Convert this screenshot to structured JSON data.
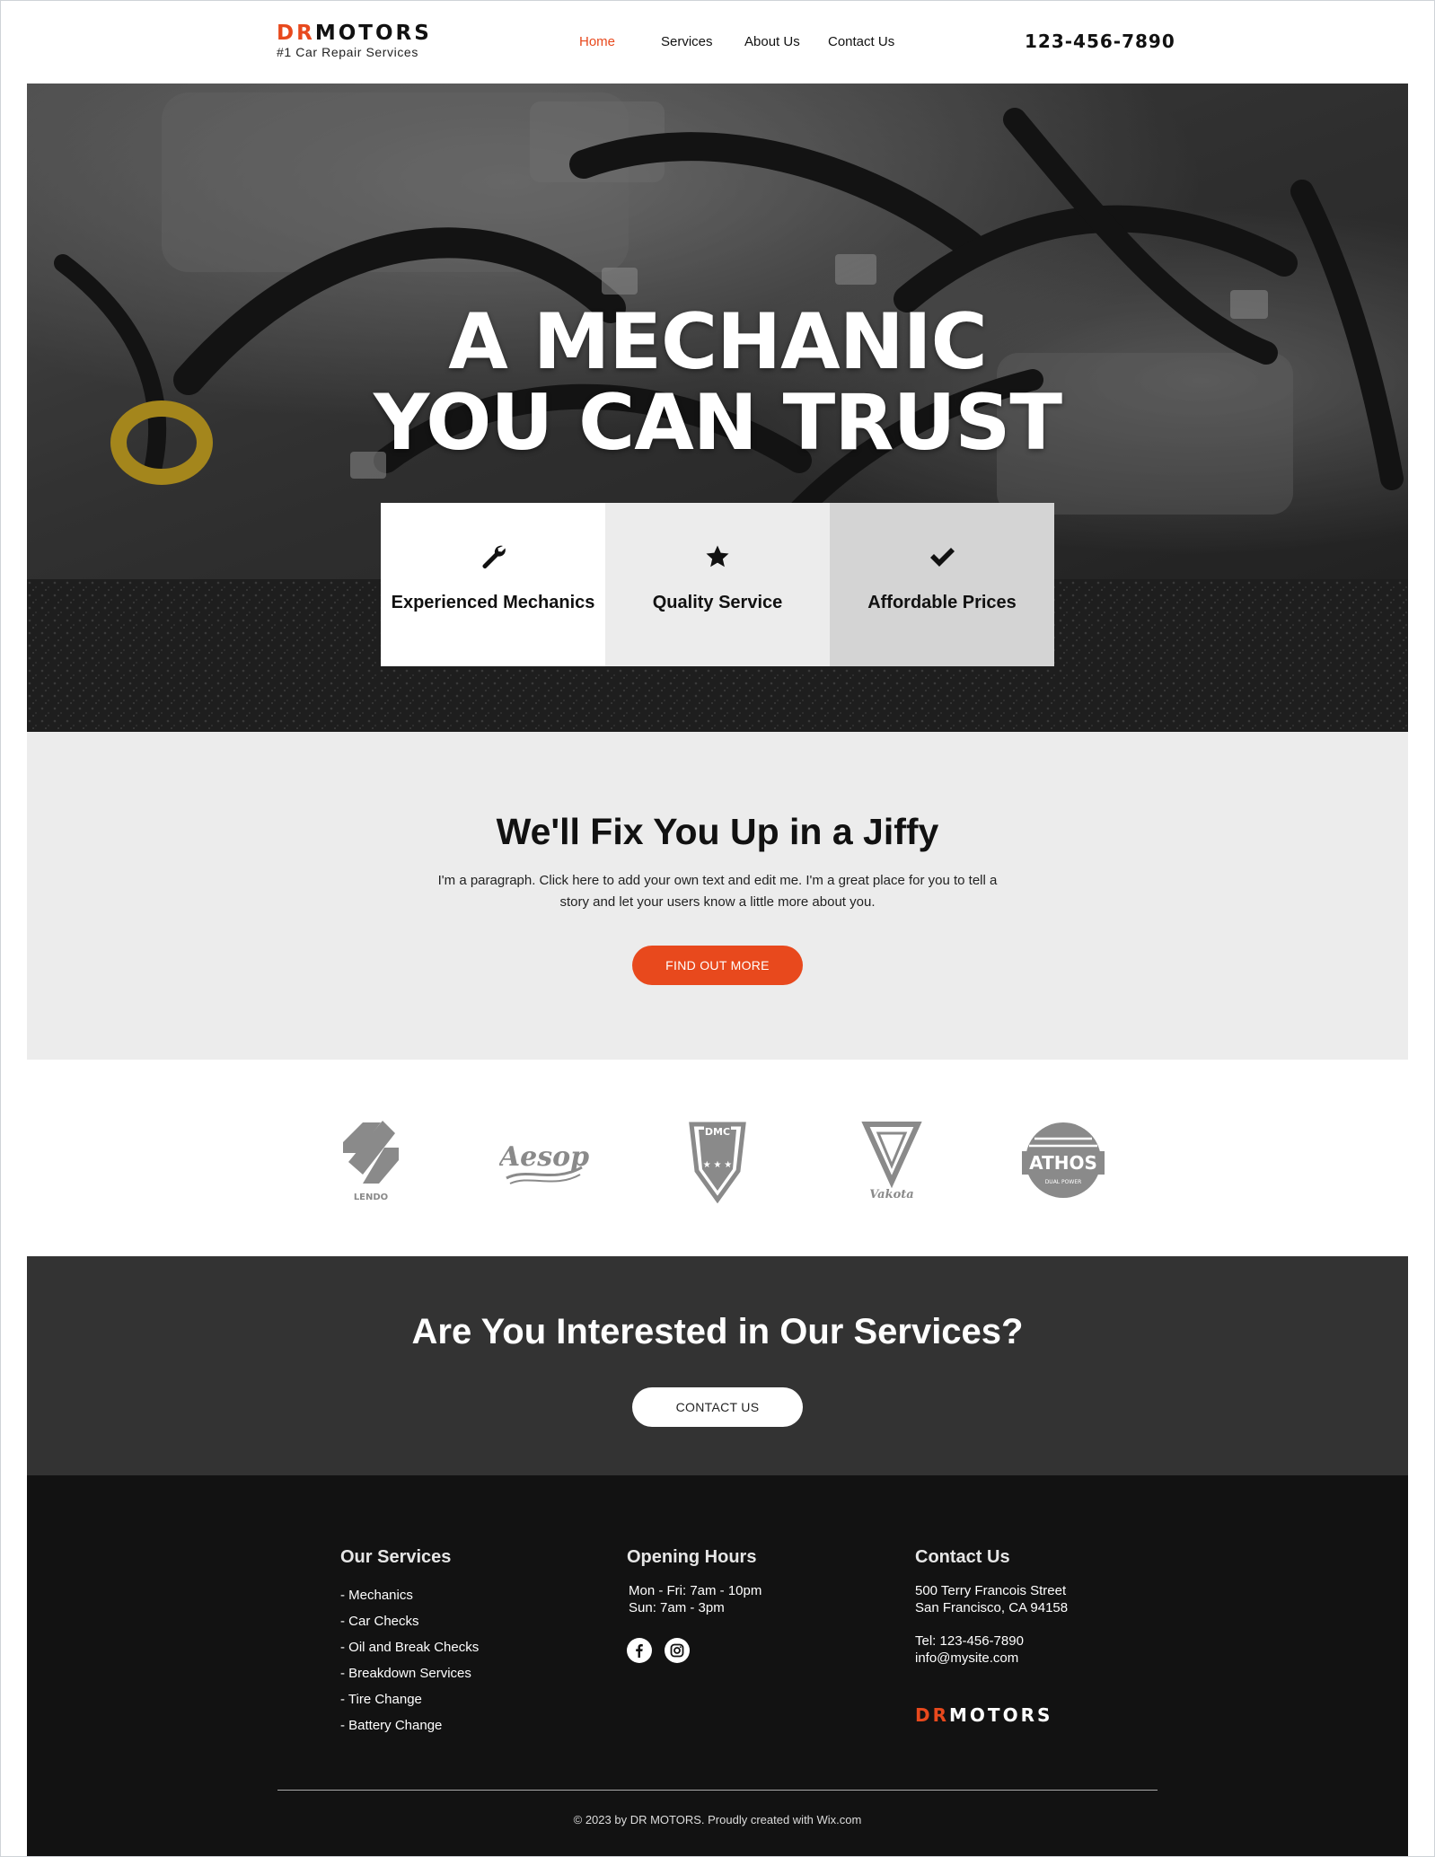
{
  "header": {
    "logo_dr": "DR",
    "logo_motors": "MOTORS",
    "tagline": "#1 Car Repair Services",
    "nav": [
      {
        "label": "Home",
        "active": true
      },
      {
        "label": "Services",
        "active": false
      },
      {
        "label": "About Us",
        "active": false
      },
      {
        "label": "Contact Us",
        "active": false
      }
    ],
    "phone": "123-456-7890"
  },
  "hero": {
    "title_line1": "A MECHANIC",
    "title_line2": "YOU CAN TRUST",
    "features": [
      {
        "label": "Experienced Mechanics",
        "icon": "wrench-icon"
      },
      {
        "label": "Quality Service",
        "icon": "star-icon"
      },
      {
        "label": "Affordable Prices",
        "icon": "checkmark-icon"
      }
    ]
  },
  "intro": {
    "heading": "We'll Fix You Up in a Jiffy",
    "paragraph": "I'm a paragraph. Click here to add your own text and edit me. I'm a great place for you to tell a story and let your users know a little more about you.",
    "button": "FIND OUT MORE"
  },
  "brands": [
    {
      "name": "LENDO"
    },
    {
      "name": "Aesop"
    },
    {
      "name": "DMC"
    },
    {
      "name": "Vakota"
    },
    {
      "name": "ATHOS",
      "sub": "DUAL POWER"
    }
  ],
  "cta": {
    "heading": "Are You Interested in Our Services?",
    "button": "CONTACT US"
  },
  "footer": {
    "services_title": "Our Services",
    "services": [
      "- Mechanics",
      "- Car Checks",
      "- Oil and Break Checks",
      "- Breakdown Services",
      "- Tire Change",
      "- Battery Change"
    ],
    "hours_title": "Opening Hours",
    "hours": [
      "Mon - Fri: 7am - 10pm",
      "Sun: 7am - 3pm"
    ],
    "contact_title": "Contact Us",
    "address": [
      "500 Terry Francois Street",
      "San Francisco, CA 94158"
    ],
    "tel": "Tel: 123-456-7890",
    "email": "info@mysite.com",
    "logo_dr": "DR",
    "logo_motors": "MOTORS",
    "copyright": "© 2023 by DR MOTORS. Proudly created with Wix.com"
  },
  "colors": {
    "accent": "#e8491d",
    "intro_bg": "#ececec",
    "cta_bg": "#333333",
    "footer_bg": "#121212"
  }
}
